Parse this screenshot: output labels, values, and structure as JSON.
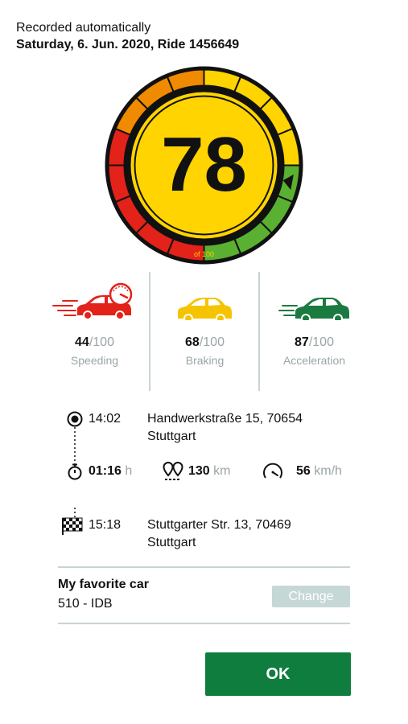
{
  "header": {
    "subtitle": "Recorded automatically",
    "title": "Saturday, 6. Jun. 2020, Ride 1456649"
  },
  "score": {
    "value": "78",
    "of_label": "of 100",
    "pointer_fraction": 0.78,
    "colors": {
      "red": "#e32219",
      "orange": "#f08a00",
      "yellow": "#ffd400",
      "green": "#5ab030"
    }
  },
  "stats": [
    {
      "value": "44",
      "max": "/100",
      "label": "Speeding",
      "icon": "speeding-car-icon",
      "color": "#e32219"
    },
    {
      "value": "68",
      "max": "/100",
      "label": "Braking",
      "icon": "braking-car-icon",
      "color": "#f5c400"
    },
    {
      "value": "87",
      "max": "/100",
      "label": "Acceleration",
      "icon": "acceleration-car-icon",
      "color": "#1b7a40"
    }
  ],
  "trip": {
    "start_time": "14:02",
    "start_address": "Handwerkstraße 15, 70654 Stuttgart",
    "duration": "01:16",
    "duration_unit": "h",
    "distance": "130",
    "distance_unit": "km",
    "avg_speed": "56",
    "avg_speed_unit": "km/h",
    "end_time": "15:18",
    "end_address": "Stuttgarter Str. 13, 70469 Stuttgart"
  },
  "car": {
    "title": "My favorite car",
    "plate": "510 - IDB",
    "change_label": "Change"
  },
  "ok_label": "OK"
}
